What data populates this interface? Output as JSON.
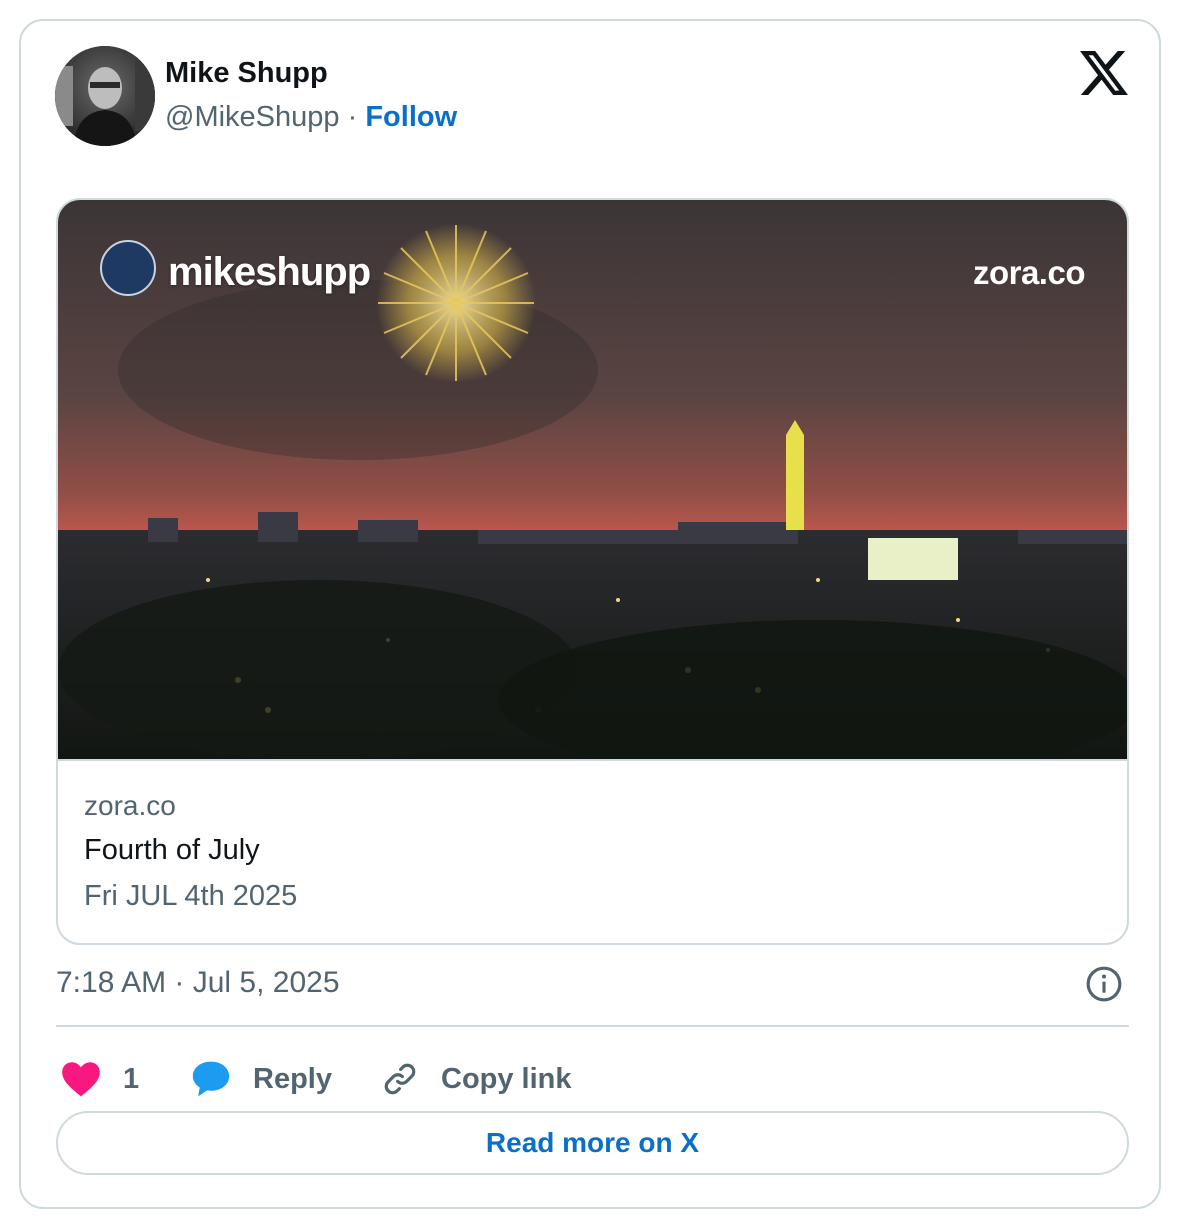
{
  "author": {
    "name": "Mike Shupp",
    "handle": "@MikeShupp",
    "separator": "·",
    "follow_label": "Follow"
  },
  "media": {
    "overlay_brand": "mikeshupp",
    "overlay_site": "zora.co",
    "link_domain": "zora.co",
    "link_title": "Fourth of July",
    "link_description": "Fri JUL 4th 2025"
  },
  "timestamp": "7:18 AM · Jul 5, 2025",
  "actions": {
    "like_count": "1",
    "reply_label": "Reply",
    "copy_label": "Copy link"
  },
  "read_more_label": "Read more on X",
  "colors": {
    "accent": "#0b6ec7",
    "like": "#f91880",
    "reply": "#1d9bf0",
    "muted": "#536471",
    "border": "#cfd9de"
  },
  "icons": [
    "x-logo-icon",
    "info-icon",
    "heart-icon",
    "reply-bubble-icon",
    "link-icon"
  ]
}
